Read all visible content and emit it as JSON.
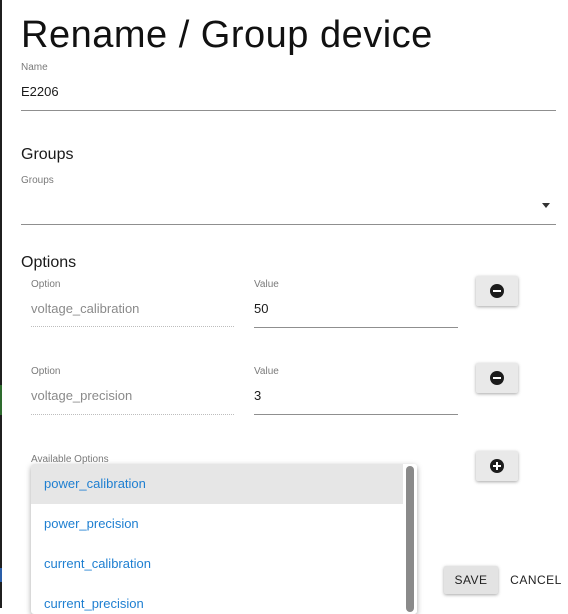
{
  "dialog": {
    "title": "Rename / Group device"
  },
  "name_field": {
    "label": "Name",
    "value": "E2206"
  },
  "groups": {
    "section_title": "Groups",
    "field_label": "Groups",
    "value": ""
  },
  "options": {
    "section_title": "Options",
    "rows": [
      {
        "option_label": "Option",
        "option_value": "voltage_calibration",
        "value_label": "Value",
        "value": "50"
      },
      {
        "option_label": "Option",
        "option_value": "voltage_precision",
        "value_label": "Value",
        "value": "3"
      }
    ],
    "available_label": "Available Options",
    "menu_items": [
      "power_calibration",
      "power_precision",
      "current_calibration",
      "current_precision"
    ],
    "selected_index": 0
  },
  "actions": {
    "save": "SAVE",
    "cancel": "CANCEL"
  },
  "colors": {
    "link_blue": "#1e7fd1",
    "menu_selected": "#e6e6e6"
  },
  "icons": {
    "remove": "minus-circle-icon",
    "add": "plus-circle-icon",
    "dropdown": "caret-down-icon"
  }
}
